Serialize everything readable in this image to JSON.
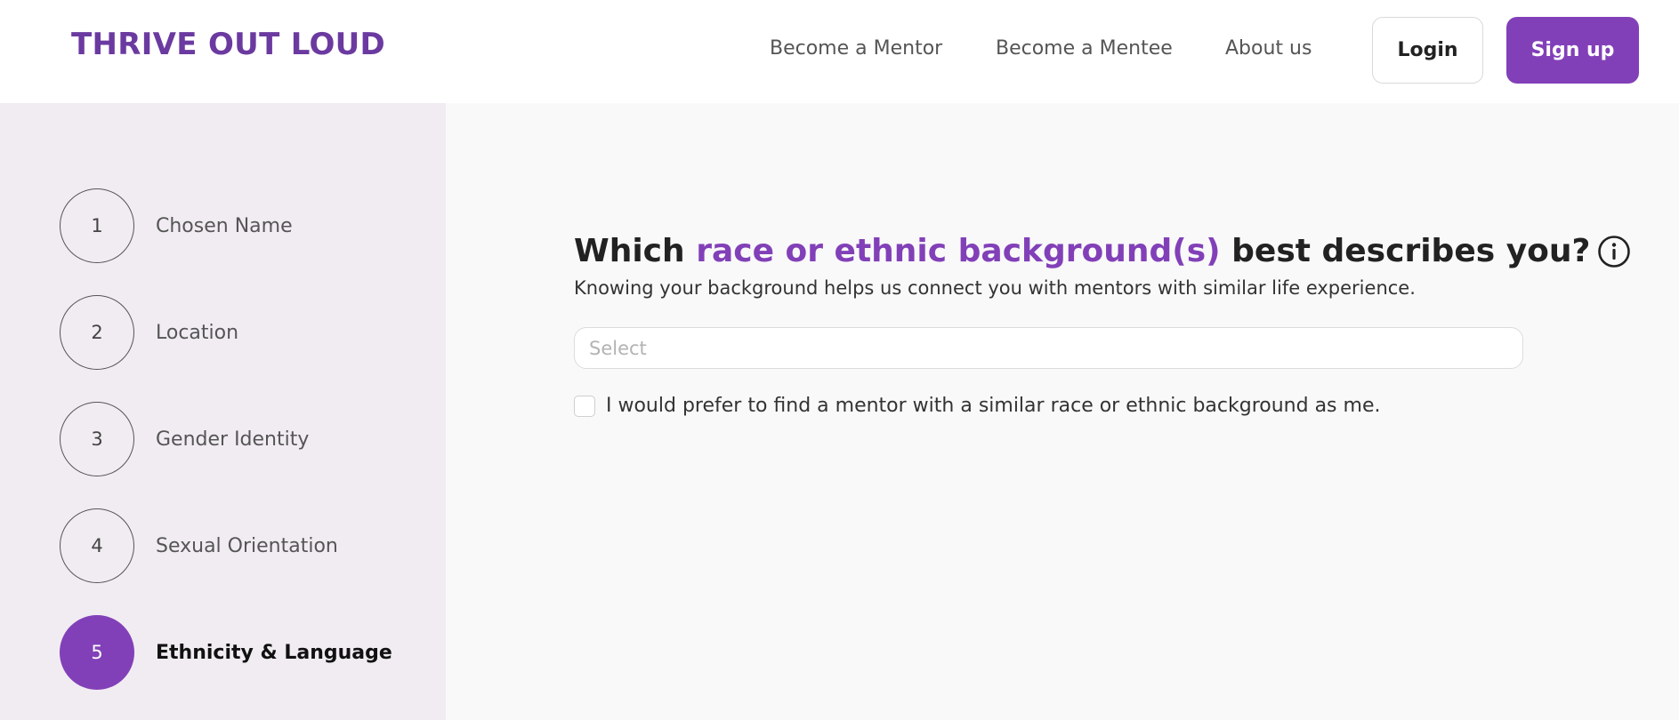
{
  "header": {
    "brand": "THRIVE OUT LOUD",
    "nav": [
      {
        "label": "Become a Mentor"
      },
      {
        "label": "Become a Mentee"
      },
      {
        "label": "About us"
      }
    ],
    "login_label": "Login",
    "signup_label": "Sign up"
  },
  "sidebar": {
    "steps": [
      {
        "number": "1",
        "label": "Chosen Name",
        "active": false
      },
      {
        "number": "2",
        "label": "Location",
        "active": false
      },
      {
        "number": "3",
        "label": "Gender Identity",
        "active": false
      },
      {
        "number": "4",
        "label": "Sexual Orientation",
        "active": false
      },
      {
        "number": "5",
        "label": "Ethnicity & Language",
        "active": true
      }
    ]
  },
  "main": {
    "question": {
      "prefix": "Which ",
      "highlight": "race or ethnic background(s)",
      "suffix": " best describes you?"
    },
    "info_icon": "info-circle-icon",
    "subtitle": "Knowing your background helps us connect you with mentors with similar life experience.",
    "select": {
      "placeholder": "Select",
      "value": ""
    },
    "preference": {
      "checked": false,
      "label": "I would prefer to find a mentor with a similar race or ethnic background as me."
    }
  },
  "colors": {
    "brand": "#6b3aa0",
    "accent": "#8240b8",
    "sidebar_bg": "#f1ecf2",
    "main_bg": "#f9f9f9"
  }
}
